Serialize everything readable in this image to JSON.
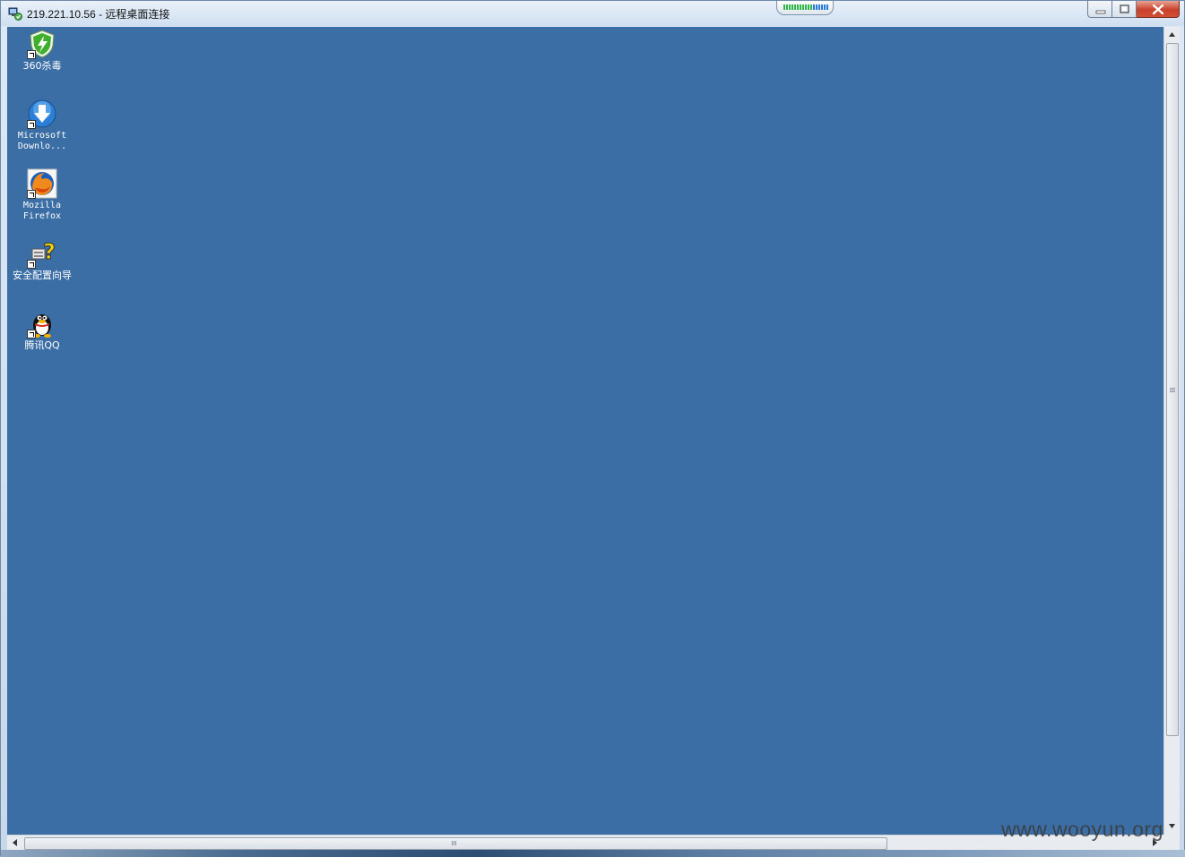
{
  "window": {
    "title": "219.221.10.56 - 远程桌面连接",
    "controls": [
      "minimize",
      "maximize",
      "close"
    ]
  },
  "connection_bar": {
    "icon": "signal-strength-icon"
  },
  "desktop": {
    "background": "#3b6ea5",
    "icons": [
      {
        "label": "360杀毒",
        "icon": "360-antivirus-shield-icon"
      },
      {
        "label_line1": "Microsoft",
        "label_line2": "Downlo...",
        "icon": "download-arrow-globe-icon"
      },
      {
        "label_line1": "Mozilla",
        "label_line2": "Firefox",
        "icon": "firefox-icon"
      },
      {
        "label": "安全配置向导",
        "icon": "security-wizard-icon"
      },
      {
        "label": "腾讯QQ",
        "icon": "qq-penguin-icon"
      }
    ]
  },
  "watermark": "www.wooyun.org",
  "colors": {
    "desktop": "#3b6ea5",
    "close_button": "#c8412b",
    "titlebar": "#dbe7f4"
  }
}
